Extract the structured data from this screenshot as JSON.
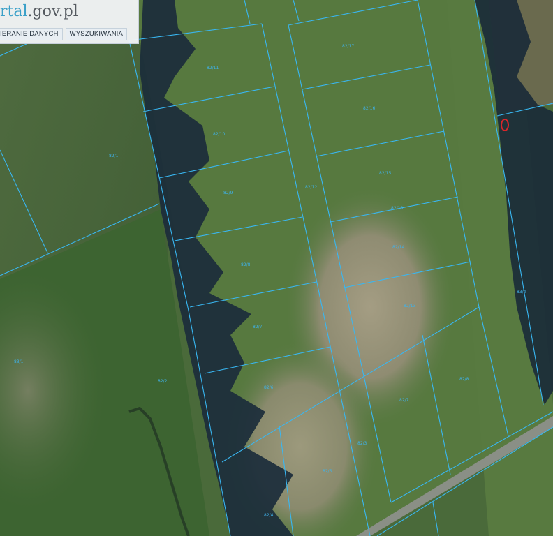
{
  "header": {
    "brand_part1": "rtal",
    "brand_part2": ".gov.pl",
    "nav": [
      "IERANIE DANYCH",
      "WYSZUKIWANIA"
    ]
  },
  "parcels": [
    {
      "id": "p1",
      "label": "82/11"
    },
    {
      "id": "p2",
      "label": "82/10"
    },
    {
      "id": "p3",
      "label": "82/9"
    },
    {
      "id": "p4",
      "label": "82/8"
    },
    {
      "id": "p5",
      "label": "82/7"
    },
    {
      "id": "p6",
      "label": "82/6"
    },
    {
      "id": "p7",
      "label": "82/5"
    },
    {
      "id": "p8",
      "label": "82/4"
    },
    {
      "id": "p9",
      "label": "82/17"
    },
    {
      "id": "p10",
      "label": "82/16"
    },
    {
      "id": "p11",
      "label": "82/15"
    },
    {
      "id": "p12",
      "label": "82/14"
    },
    {
      "id": "p13",
      "label": "82/13"
    },
    {
      "id": "p14",
      "label": "82/12"
    },
    {
      "id": "p15",
      "label": "82/8"
    },
    {
      "id": "p16",
      "label": "82/7"
    },
    {
      "id": "p17",
      "label": "82/3"
    },
    {
      "id": "p18",
      "label": "82/2"
    },
    {
      "id": "p19",
      "label": "82/1"
    },
    {
      "id": "p20",
      "label": "83/1"
    },
    {
      "id": "p21",
      "label": "83/4"
    },
    {
      "id": "p22",
      "label": "82/18"
    }
  ],
  "colors": {
    "boundary": "#39b7f2",
    "label": "#3fb2ea",
    "marker": "#d8262a",
    "meadow": "#4d6b3c",
    "bare_soil": "#9b957c",
    "tree_shadow": "#1a2a38"
  },
  "marker_icon": "map-pin-icon"
}
